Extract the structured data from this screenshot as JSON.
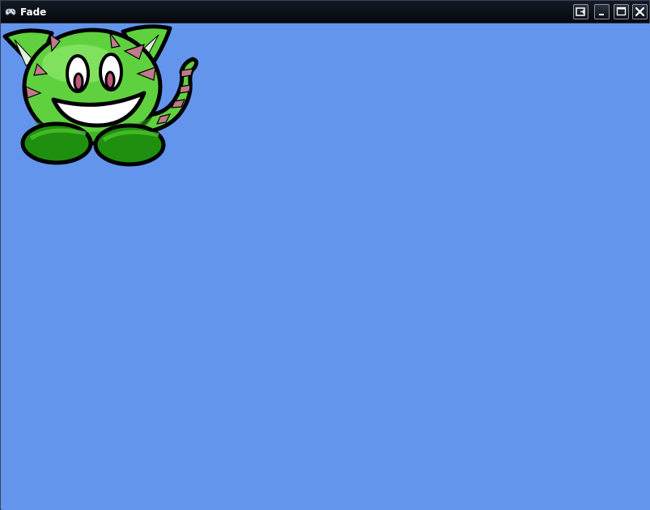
{
  "window": {
    "title": "Fade",
    "icon": "gamepad-icon",
    "background": "#6495ED",
    "buttons": [
      "restore-out-icon",
      "minimize-icon",
      "maximize-icon",
      "close-icon"
    ]
  },
  "sprite": {
    "name": "green-cat-creature",
    "colors": {
      "body": "#5fd13f",
      "body_dark": "#2aa012",
      "feet": "#1e8f0e",
      "stripes": "#c07a8a",
      "outline": "#000000"
    }
  }
}
